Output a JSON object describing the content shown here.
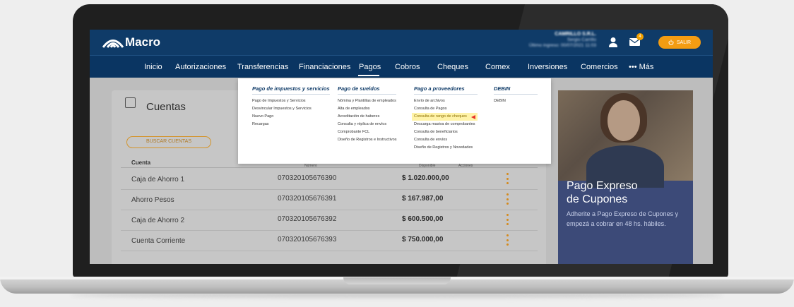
{
  "app": {
    "logo_text": "Macro",
    "user_name": "CAMRILLO S.R.L.",
    "user_person": "Sergio Carrillo",
    "last_login": "Último ingreso: 00/07/2021 11:03",
    "mail_count": "4",
    "exit_label": "SALIR"
  },
  "nav": {
    "items": [
      "Inicio",
      "Autorizaciones",
      "Transferencias",
      "Financiaciones",
      "Pagos",
      "Cobros",
      "Cheques",
      "Comex",
      "Inversiones",
      "Comercios",
      "••• Más"
    ],
    "active": "Pagos"
  },
  "menu": {
    "columns": [
      {
        "title": "Pago de impuestos y servicios",
        "items": [
          "Pago de Impuestos y Servicios",
          "Desvincular Impuestos y Servicios",
          "Nuevo Pago",
          "Recargas"
        ]
      },
      {
        "title": "Pago de sueldos",
        "items": [
          "Nómina y Plantillas de empleados",
          "Alta de empleados",
          "Acreditación de haberes",
          "Consulta y réplica de envíos",
          "Comprobante FCL",
          "Diseño de Registros e Instructivos"
        ]
      },
      {
        "title": "Pago a proveedores",
        "items": [
          "Envío de archivos",
          "Consulta de Pagos",
          "Consulta de rango de cheques",
          "Descarga masiva de comprobantes",
          "Consulta de beneficiarios",
          "Consulta de envíos",
          "Diseño de Registros y Novedades"
        ],
        "highlighted_index": 2
      },
      {
        "title": "DEBIN",
        "items": [
          "DEBIN"
        ]
      }
    ]
  },
  "cuentas": {
    "title": "Cuentas",
    "search_button": "BUSCAR CUENTAS",
    "headers": [
      "Cuenta",
      "Número",
      "Disponible",
      "Acciones"
    ],
    "rows": [
      {
        "name": "Caja de Ahorro 1",
        "number": "070320105676390",
        "amount": "$ 1.020.000,00"
      },
      {
        "name": "Ahorro Pesos",
        "number": "070320105676391",
        "amount": "$ 167.987,00"
      },
      {
        "name": "Caja de Ahorro 2",
        "number": "070320105676392",
        "amount": "$ 600.500,00"
      },
      {
        "name": "Cuenta Corriente",
        "number": "070320105676393",
        "amount": "$ 750.000,00"
      }
    ]
  },
  "promo": {
    "title_line1": "Pago Expreso",
    "title_line2": "de Cupones",
    "text": "Adherite a Pago Expreso de Cupones y empezá a cobrar en 48 hs. hábiles."
  },
  "colors": {
    "brand_navy": "#0f3b68",
    "accent_orange": "#f39c12",
    "highlight_yellow": "#fff3a8",
    "arrow_red": "#e8332a"
  }
}
